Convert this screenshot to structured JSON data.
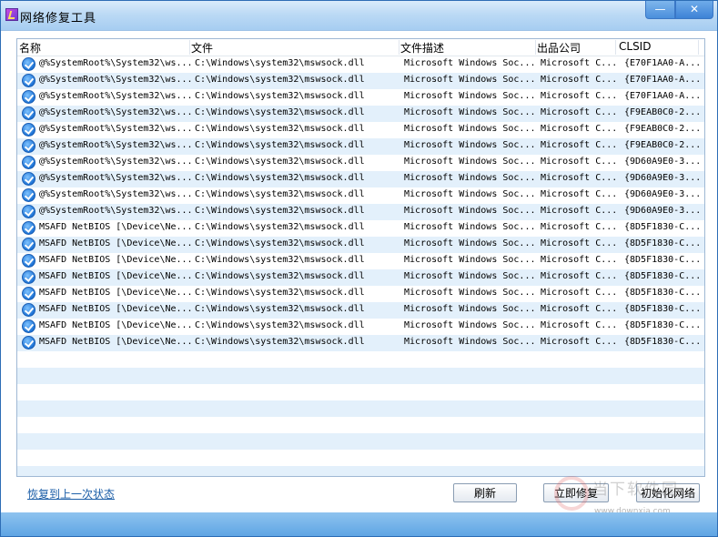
{
  "window": {
    "title": "网络修复工具",
    "minimize_glyph": "—",
    "close_glyph": "✕"
  },
  "table": {
    "columns": [
      "名称",
      "文件",
      "文件描述",
      "出品公司",
      "CLSID"
    ],
    "rows": [
      [
        "@%SystemRoot%\\System32\\ws...",
        "C:\\Windows\\system32\\mswsock.dll",
        "Microsoft Windows Soc...",
        "Microsoft C...",
        "{E70F1AA0-A..."
      ],
      [
        "@%SystemRoot%\\System32\\ws...",
        "C:\\Windows\\system32\\mswsock.dll",
        "Microsoft Windows Soc...",
        "Microsoft C...",
        "{E70F1AA0-A..."
      ],
      [
        "@%SystemRoot%\\System32\\ws...",
        "C:\\Windows\\system32\\mswsock.dll",
        "Microsoft Windows Soc...",
        "Microsoft C...",
        "{E70F1AA0-A..."
      ],
      [
        "@%SystemRoot%\\System32\\ws...",
        "C:\\Windows\\system32\\mswsock.dll",
        "Microsoft Windows Soc...",
        "Microsoft C...",
        "{F9EAB0C0-2..."
      ],
      [
        "@%SystemRoot%\\System32\\ws...",
        "C:\\Windows\\system32\\mswsock.dll",
        "Microsoft Windows Soc...",
        "Microsoft C...",
        "{F9EAB0C0-2..."
      ],
      [
        "@%SystemRoot%\\System32\\ws...",
        "C:\\Windows\\system32\\mswsock.dll",
        "Microsoft Windows Soc...",
        "Microsoft C...",
        "{F9EAB0C0-2..."
      ],
      [
        "@%SystemRoot%\\System32\\ws...",
        "C:\\Windows\\system32\\mswsock.dll",
        "Microsoft Windows Soc...",
        "Microsoft C...",
        "{9D60A9E0-3..."
      ],
      [
        "@%SystemRoot%\\System32\\ws...",
        "C:\\Windows\\system32\\mswsock.dll",
        "Microsoft Windows Soc...",
        "Microsoft C...",
        "{9D60A9E0-3..."
      ],
      [
        "@%SystemRoot%\\System32\\ws...",
        "C:\\Windows\\system32\\mswsock.dll",
        "Microsoft Windows Soc...",
        "Microsoft C...",
        "{9D60A9E0-3..."
      ],
      [
        "@%SystemRoot%\\System32\\ws...",
        "C:\\Windows\\system32\\mswsock.dll",
        "Microsoft Windows Soc...",
        "Microsoft C...",
        "{9D60A9E0-3..."
      ],
      [
        "MSAFD NetBIOS [\\Device\\Ne...",
        "C:\\Windows\\system32\\mswsock.dll",
        "Microsoft Windows Soc...",
        "Microsoft C...",
        "{8D5F1830-C..."
      ],
      [
        "MSAFD NetBIOS [\\Device\\Ne...",
        "C:\\Windows\\system32\\mswsock.dll",
        "Microsoft Windows Soc...",
        "Microsoft C...",
        "{8D5F1830-C..."
      ],
      [
        "MSAFD NetBIOS [\\Device\\Ne...",
        "C:\\Windows\\system32\\mswsock.dll",
        "Microsoft Windows Soc...",
        "Microsoft C...",
        "{8D5F1830-C..."
      ],
      [
        "MSAFD NetBIOS [\\Device\\Ne...",
        "C:\\Windows\\system32\\mswsock.dll",
        "Microsoft Windows Soc...",
        "Microsoft C...",
        "{8D5F1830-C..."
      ],
      [
        "MSAFD NetBIOS [\\Device\\Ne...",
        "C:\\Windows\\system32\\mswsock.dll",
        "Microsoft Windows Soc...",
        "Microsoft C...",
        "{8D5F1830-C..."
      ],
      [
        "MSAFD NetBIOS [\\Device\\Ne...",
        "C:\\Windows\\system32\\mswsock.dll",
        "Microsoft Windows Soc...",
        "Microsoft C...",
        "{8D5F1830-C..."
      ],
      [
        "MSAFD NetBIOS [\\Device\\Ne...",
        "C:\\Windows\\system32\\mswsock.dll",
        "Microsoft Windows Soc...",
        "Microsoft C...",
        "{8D5F1830-C..."
      ],
      [
        "MSAFD NetBIOS [\\Device\\Ne...",
        "C:\\Windows\\system32\\mswsock.dll",
        "Microsoft Windows Soc...",
        "Microsoft C...",
        "{8D5F1830-C..."
      ]
    ],
    "row_icon": "check-circle-icon"
  },
  "footer": {
    "restore_link": "恢复到上一次状态",
    "refresh_label": "刷新",
    "repair_label": "立即修复",
    "reset_label": "初始化网络"
  },
  "watermark": {
    "text": "当下软件园",
    "url": "www.downxia.com"
  },
  "colors": {
    "titlebar": "#bcdaf5",
    "statusbar": "#5fa5e4",
    "row_alt": "#e3f0fb",
    "check": "#1e74d6",
    "link": "#1d5fa8"
  }
}
